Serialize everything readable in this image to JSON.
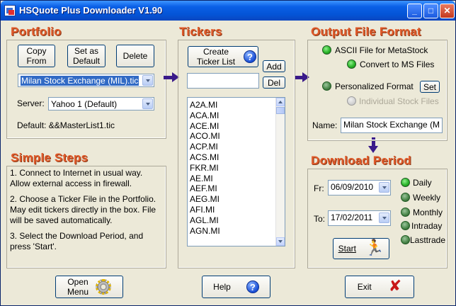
{
  "window": {
    "title": "HSQuote Plus Downloader V1.90",
    "min": "_",
    "max": "□",
    "close": "✕"
  },
  "portfolio": {
    "heading": "Portfolio",
    "copy_from": [
      "Copy",
      "From"
    ],
    "set_default": [
      "Set as",
      "Default"
    ],
    "delete": "Delete",
    "file_select": "Milan Stock Exchange (MIL).tic",
    "server_label": "Server:",
    "server_select": "Yahoo 1 (Default)",
    "default_label": "Default: &&MasterList1.tic"
  },
  "steps": {
    "heading": "Simple Steps",
    "items": [
      "1. Connect to Internet in usual way.     Allow external access in firewall.",
      "2. Choose a Ticker File in the Portfolio. May edit tickers directly in the box. File will be saved automatically.",
      "3. Select the Download Period, and press 'Start'."
    ]
  },
  "tickers": {
    "heading": "Tickers",
    "create": [
      "Create",
      "Ticker List"
    ],
    "add": "Add",
    "del": "Del",
    "input_value": "",
    "list": [
      "A2A.MI",
      "ACA.MI",
      "ACE.MI",
      "ACO.MI",
      "ACP.MI",
      "ACS.MI",
      "FKR.MI",
      "AE.MI",
      "AEF.MI",
      "AEG.MI",
      "AFI.MI",
      "AGL.MI",
      "AGN.MI"
    ]
  },
  "output": {
    "heading": "Output File Format",
    "ascii": "ASCII File for MetaStock",
    "convert": "Convert to MS Files",
    "personalized": "Personalized Format",
    "set": "Set",
    "individual": "Individual Stock Files",
    "name_label": "Name:",
    "name_value": "Milan Stock Exchange (M"
  },
  "download": {
    "heading": "Download Period",
    "fr_label": "Fr:",
    "fr_value": "06/09/2010",
    "to_label": "To:",
    "to_value": "17/02/2011",
    "periods": [
      "Daily",
      "Weekly",
      "Monthly",
      "Intraday",
      "Lasttrade"
    ],
    "start": "Start"
  },
  "bottom": {
    "open_menu": [
      "Open",
      "Menu"
    ],
    "help": "Help",
    "exit": "Exit"
  }
}
